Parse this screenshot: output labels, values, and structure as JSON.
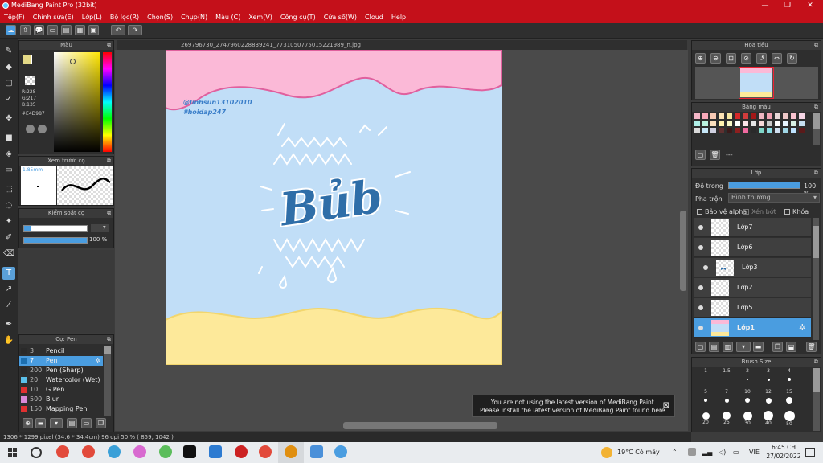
{
  "window": {
    "title": "MediBang Paint Pro (32bit)",
    "minimize": "—",
    "maximize": "❐",
    "close": "✕"
  },
  "menu": [
    "Tệp(F)",
    "Chỉnh sửa(E)",
    "Lớp(L)",
    "Bộ lọc(R)",
    "Chọn(S)",
    "Chụp(N)",
    "Màu (C)",
    "Xem(V)",
    "Công cụ(T)",
    "Cửa sổ(W)",
    "Cloud",
    "Help"
  ],
  "document": {
    "tab_title": "269796730_2747960228839241_7731050775015221989_n.jpg"
  },
  "canvas": {
    "watermark_line1": "@linhsun13102010",
    "watermark_line2": "#hoidap247",
    "art_text": "Bủb",
    "colors": {
      "sky": "#c1def7",
      "top_wave": "#fbb9d7",
      "top_wave_edge": "#e0609e",
      "bottom_wave": "#fde99a",
      "bottom_wave_edge": "#f2d66e",
      "text_blue": "#2f6ea8"
    }
  },
  "color_panel": {
    "title": "Màu",
    "r": "R:228",
    "g": "G:217",
    "b": "B:135",
    "hex": "#E4D987",
    "current_color": "#e4d987"
  },
  "brush_preview": {
    "title": "Xem trước cọ",
    "size": "1.85mm"
  },
  "brush_control": {
    "title": "Kiểm soát cọ",
    "size_value": "7",
    "opacity_value": "100 %"
  },
  "brush_panel": {
    "title": "Cọ: Pen",
    "items": [
      {
        "num": "3",
        "name": "Pencil",
        "color": "#2a2a2a"
      },
      {
        "num": "7",
        "name": "Pen",
        "color": "#1c6fb0"
      },
      {
        "num": "200",
        "name": "Pen (Sharp)",
        "color": "#2a2a2a"
      },
      {
        "num": "20",
        "name": "Watercolor (Wet)",
        "color": "#5bc0ea"
      },
      {
        "num": "10",
        "name": "G Pen",
        "color": "#e03030"
      },
      {
        "num": "500",
        "name": "Blur",
        "color": "#d88ad8"
      },
      {
        "num": "150",
        "name": "Mapping Pen",
        "color": "#e03030"
      }
    ]
  },
  "navigator": {
    "title": "Hoa tiêu"
  },
  "palette": {
    "title": "Bảng màu",
    "label": "---",
    "colors": [
      "#f4b7c7",
      "#f8a9b9",
      "#f7c9b3",
      "#fde3b5",
      "#f7e7a0",
      "#d62929",
      "#d23c3c",
      "#a41818",
      "#f0b6c1",
      "#f3a2b3",
      "#e8d7d7",
      "#f0c9c9",
      "#f9c3cf",
      "#f5d5e5",
      "#b0f0e8",
      "#b9f2df",
      "#fbe0bf",
      "#fff3b0",
      "#f7f7c6",
      "#ffffff",
      "#fbe4ea",
      "#e5e5e5",
      "#f7d9d9",
      "#c9c9c9",
      "#ffffff",
      "#e9f5ff",
      "#d7f0e4",
      "#c6dff0",
      "#d9d9d9",
      "#c5e6f7",
      "#d0d0e0",
      "#5f3030",
      "#3a1a1a",
      "#8e1f1f",
      "#f06aa0",
      "#2a2a2a",
      "#7fd6c8",
      "#8cdce4",
      "#d0e0f0",
      "#a0d7e6",
      "#bfe3ff",
      "#5a1a1a"
    ]
  },
  "layer_panel": {
    "title": "Lớp",
    "opacity_label": "Độ trong",
    "opacity_value": "100 %",
    "blend_label": "Pha trộn",
    "blend_value": "Bình thường",
    "protect_alpha": "Bảo vệ alpha",
    "clipping": "Xén bớt",
    "lock": "Khóa",
    "layers": [
      "Lớp7",
      "Lớp6",
      "Lớp3",
      "Lớp2",
      "Lớp5",
      "Lớp1"
    ]
  },
  "brush_size": {
    "title": "Brush Size",
    "sizes": [
      "1",
      "1.5",
      "2",
      "3",
      "4",
      "5",
      "7",
      "10",
      "12",
      "15",
      "20",
      "25",
      "30",
      "40",
      "50"
    ]
  },
  "status": {
    "text": "1306 * 1299 pixel   (34.6 * 34.4cm)   96 dpi   50 %   ( 859, 1042 )"
  },
  "notice": {
    "line1": "You are not using the latest version of MediBang Paint.",
    "line2": "Please install the latest version of MediBang Paint found here.",
    "close": "⊠"
  },
  "taskbar": {
    "weather": "19°C  Có mây",
    "lang": "VIE",
    "time": "6:45 CH",
    "date": "27/02/2022"
  }
}
